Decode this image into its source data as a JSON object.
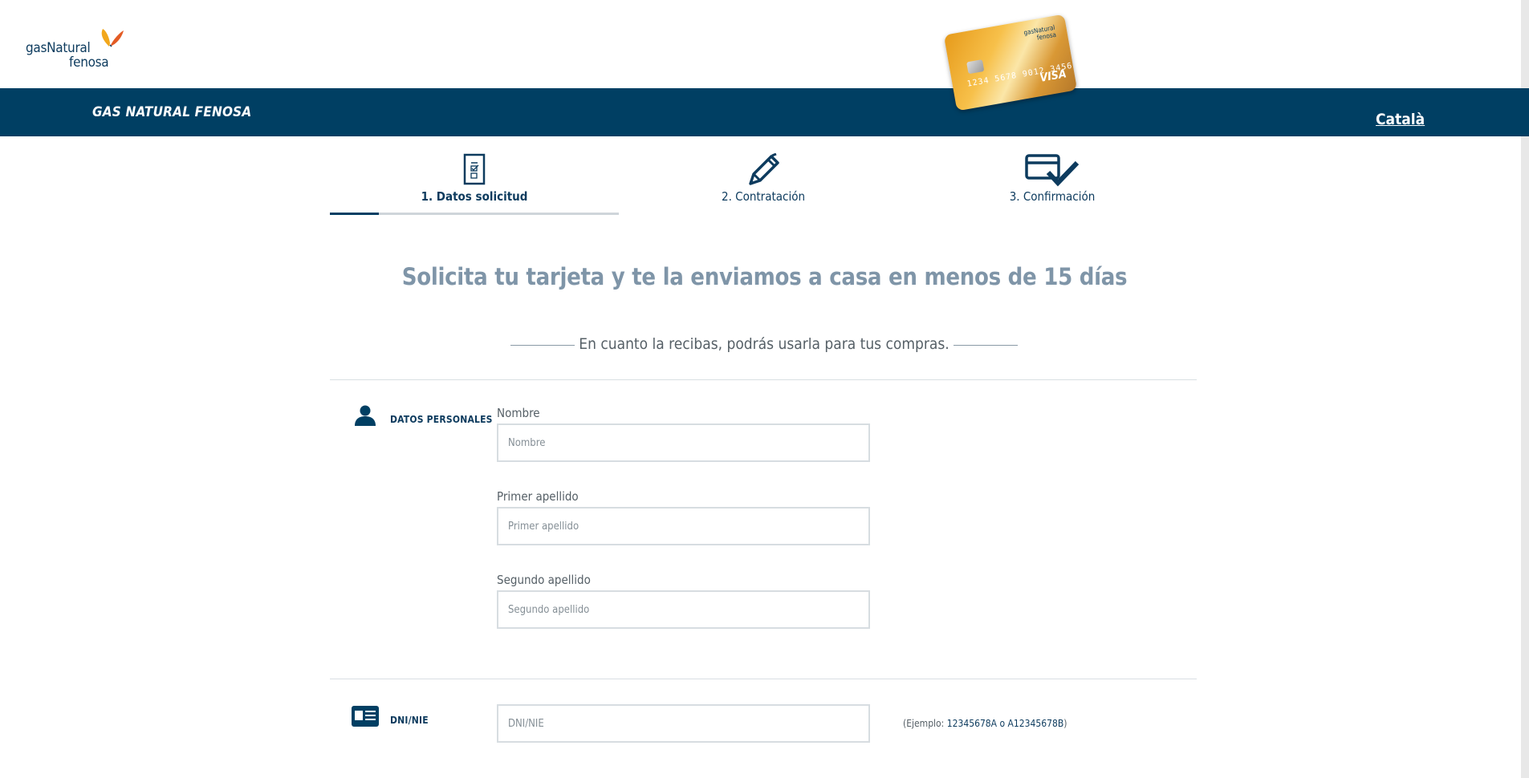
{
  "header": {
    "logo_line1": "gasNatural",
    "logo_line2": "fenosa",
    "card_number": "1234 5678 9012 3456",
    "card_brand": "VISA",
    "card_issuer_line1": "gasNatural",
    "card_issuer_line2": "fenosa",
    "brand_title": "GAS NATURAL FENOSA",
    "language_link": "Català"
  },
  "steps": [
    {
      "label": "1. Datos solicitud",
      "icon": "form-document-icon",
      "active": true
    },
    {
      "label": "2. Contratación",
      "icon": "pen-icon",
      "active": false
    },
    {
      "label": "3. Confirmación",
      "icon": "card-check-icon",
      "active": false
    }
  ],
  "progress": {
    "fraction_of_step1": 0.17
  },
  "headline": "Solicita tu tarjeta y te la enviamos a casa en menos de 15 días",
  "subline": "En cuanto la recibas, podrás usarla para tus compras.",
  "personal": {
    "section_title": "DATOS PERSONALES",
    "icon": "person-icon",
    "fields": [
      {
        "label": "Nombre",
        "placeholder": "Nombre",
        "value": ""
      },
      {
        "label": "Primer apellido",
        "placeholder": "Primer apellido",
        "value": ""
      },
      {
        "label": "Segundo apellido",
        "placeholder": "Segundo apellido",
        "value": ""
      }
    ]
  },
  "dni": {
    "section_title": "DNI/NIE",
    "icon": "id-card-icon",
    "placeholder": "DNI/NIE",
    "value": "",
    "hint_prefix": "(Ejemplo: ",
    "hint_example": "12345678A o A12345678B",
    "hint_suffix": ")"
  },
  "colors": {
    "primary": "#003f63",
    "headline": "#7f95a8",
    "accent_orange": "#f2a71b"
  }
}
